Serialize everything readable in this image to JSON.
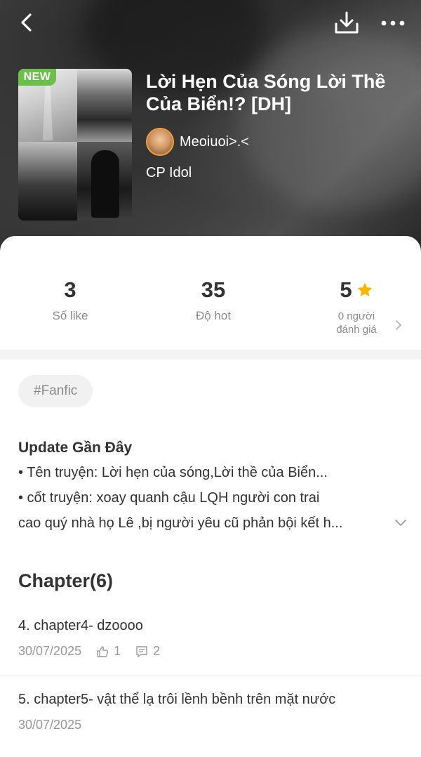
{
  "header": {
    "new_badge": "NEW",
    "title": "Lời Hẹn Của Sóng Lời Thề Của Biển!? [DH]",
    "author": "Meoiuoi>.<",
    "category": "CP Idol"
  },
  "stats": {
    "likes": {
      "value": "3",
      "label": "Số like"
    },
    "hot": {
      "value": "35",
      "label": "Độ hot"
    },
    "rating": {
      "value": "5",
      "label_line1": "0 người",
      "label_line2": "đánh giá"
    }
  },
  "tags": [
    "#Fanfic"
  ],
  "update": {
    "title": "Update Gần Đây",
    "lines": [
      "• Tên truyện: Lời hẹn của sóng,Lời thề của Biển...",
      "• cốt truyện: xoay quanh cậu LQH  người con trai",
      "cao quý nhà họ Lê ,bị người yêu cũ phản bội kết h..."
    ]
  },
  "chapters_heading": "Chapter(6)",
  "chapters": [
    {
      "title": "4. chapter4- dzoooo",
      "date": "30/07/2025",
      "likes": "1",
      "comments": "2"
    },
    {
      "title": "5. chapter5- vật thể lạ trôi lềnh bềnh trên mặt nước",
      "date": "30/07/2025"
    }
  ],
  "icons": {
    "back": "back-arrow-icon",
    "download": "download-icon",
    "more": "more-dots-icon",
    "star": "star-icon",
    "like": "thumbs-up-icon",
    "comment": "comment-icon",
    "expand": "chevron-down-icon",
    "detail": "chevron-right-icon"
  },
  "colors": {
    "new_badge": "#6cc04a",
    "star": "#f5b800",
    "avatar_border": "#f2a13b"
  }
}
